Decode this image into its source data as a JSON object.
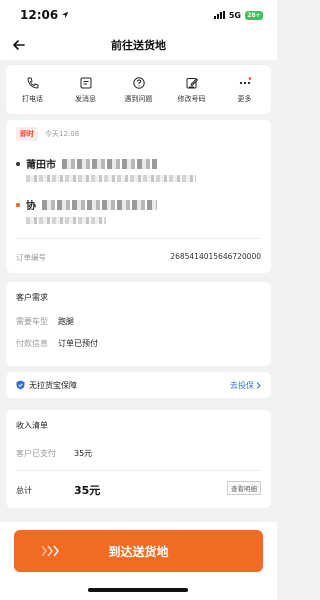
{
  "status_bar": {
    "time": "12:06",
    "network": "5G",
    "battery": "28+"
  },
  "nav": {
    "title": "前往送货地"
  },
  "actions": [
    {
      "label": "打电话",
      "icon": "phone-icon"
    },
    {
      "label": "发消息",
      "icon": "message-icon"
    },
    {
      "label": "遇到问题",
      "icon": "question-icon"
    },
    {
      "label": "修改号码",
      "icon": "edit-icon"
    },
    {
      "label": "更多",
      "icon": "more-icon"
    }
  ],
  "order": {
    "tag": "即时",
    "time": "今天12:08",
    "pickup_name": "莆田市",
    "dropoff_name": "协",
    "order_no_label": "订单编号",
    "order_no": "2685414015646720000"
  },
  "needs": {
    "title": "客户需求",
    "vehicle_label": "需要车型",
    "vehicle": "跑腿",
    "payment_label": "付款信息",
    "payment": "订单已预付"
  },
  "insurance": {
    "text": "无拉货宝保障",
    "link": "去投保"
  },
  "income": {
    "title": "收入清单",
    "paid_label": "客户已支付",
    "paid": "35元",
    "total_label": "总计",
    "total": "35元",
    "detail_button": "查看明细"
  },
  "cta": {
    "label": "到达送货地"
  },
  "colors": {
    "accent": "#f26b22",
    "link": "#2f6fd6",
    "tag_red": "#e8432f"
  }
}
